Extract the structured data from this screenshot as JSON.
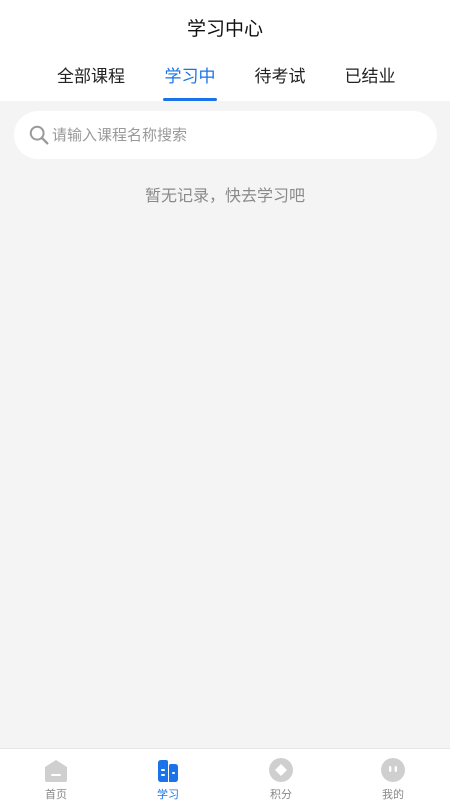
{
  "header": {
    "title": "学习中心",
    "tabs": [
      {
        "label": "全部课程",
        "active": false
      },
      {
        "label": "学习中",
        "active": true
      },
      {
        "label": "待考试",
        "active": false
      },
      {
        "label": "已结业",
        "active": false
      }
    ]
  },
  "search": {
    "placeholder": "请输入课程名称搜索",
    "value": "",
    "icon": "search-icon"
  },
  "empty_message": "暂无记录，快去学习吧",
  "tabbar": {
    "items": [
      {
        "label": "首页",
        "icon": "home-icon",
        "active": false
      },
      {
        "label": "学习",
        "icon": "study-icon",
        "active": true
      },
      {
        "label": "积分",
        "icon": "points-icon",
        "active": false
      },
      {
        "label": "我的",
        "icon": "profile-icon",
        "active": false
      }
    ]
  },
  "colors": {
    "accent": "#1a73e8",
    "background": "#f4f4f4",
    "muted_text": "#8a8a8a",
    "inactive_icon": "#cfcfcf"
  }
}
